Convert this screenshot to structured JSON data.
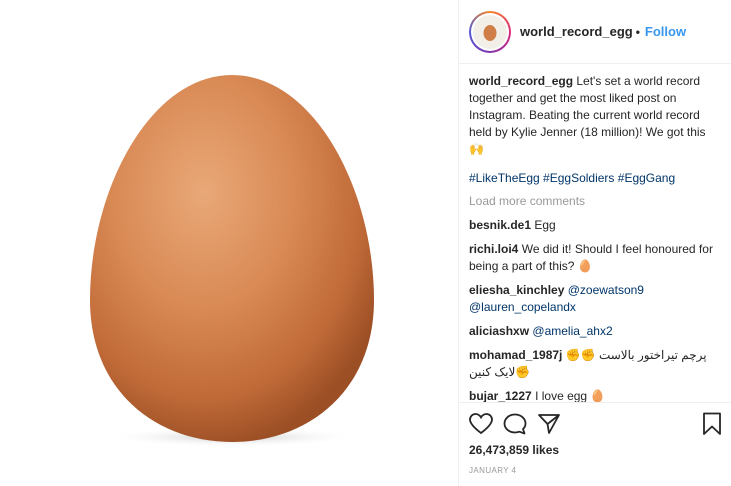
{
  "post": {
    "image_alt": "brown egg"
  },
  "header": {
    "username": "world_record_egg",
    "dot": "•",
    "follow_label": "Follow"
  },
  "caption": {
    "username": "world_record_egg",
    "text": "Let's set a world record together and get the most liked post on Instagram. Beating the current world record held by Kylie Jenner (18 million)! We got this 🙌",
    "hashtags": "#LikeTheEgg #EggSoldiers #EggGang"
  },
  "load_more": "Load more comments",
  "comments": [
    {
      "username": "besnik.de1",
      "text": "Egg"
    },
    {
      "username": "richi.loi4",
      "text": "We did it! Should I feel honoured for being a part of this? 🥚"
    },
    {
      "username": "eliesha_kinchley",
      "mention1": "@zoewatson9",
      "mention2": "@lauren_copelandx"
    },
    {
      "username": "aliciashxw",
      "mention1": "@amelia_ahx2"
    },
    {
      "username": "mohamad_1987j",
      "text": "پرچم تیراختور بالاست ✊✊✊لایک کنین"
    },
    {
      "username": "bujar_1227",
      "text": "I love egg 🥚"
    }
  ],
  "likes": "26,473,859 likes",
  "date": "JANUARY 4",
  "icons": [
    "heart-icon",
    "comment-icon",
    "share-icon",
    "bookmark-icon"
  ],
  "colors": {
    "follow": "#3897f0",
    "link": "#003569",
    "muted": "#999999"
  }
}
